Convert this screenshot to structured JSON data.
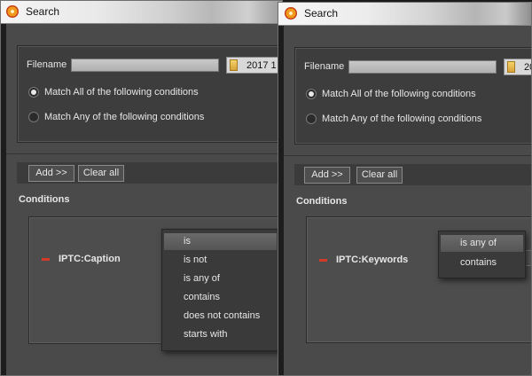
{
  "windows": [
    {
      "title": "Search",
      "filename_label": "Filename",
      "filename_value": "",
      "folder_button": "2017 1",
      "match_all": "Match All of the following conditions",
      "match_any": "Match Any of the following conditions",
      "add_button": "Add >>",
      "clear_button": "Clear all",
      "conditions_title": "Conditions",
      "condition_field": "IPTC:Caption",
      "operator_options": [
        "is",
        "is not",
        "is any of",
        "contains",
        "does not contains",
        "starts with"
      ],
      "selected_operator": "is"
    },
    {
      "title": "Search",
      "filename_label": "Filename",
      "filename_value": "",
      "folder_button": "20",
      "match_all": "Match All of the following conditions",
      "match_any": "Match Any of the following conditions",
      "add_button": "Add >>",
      "clear_button": "Clear all",
      "conditions_title": "Conditions",
      "condition_field": "IPTC:Keywords",
      "operator_options": [
        "is any of",
        "contains"
      ],
      "selected_operator": "is any of"
    }
  ]
}
